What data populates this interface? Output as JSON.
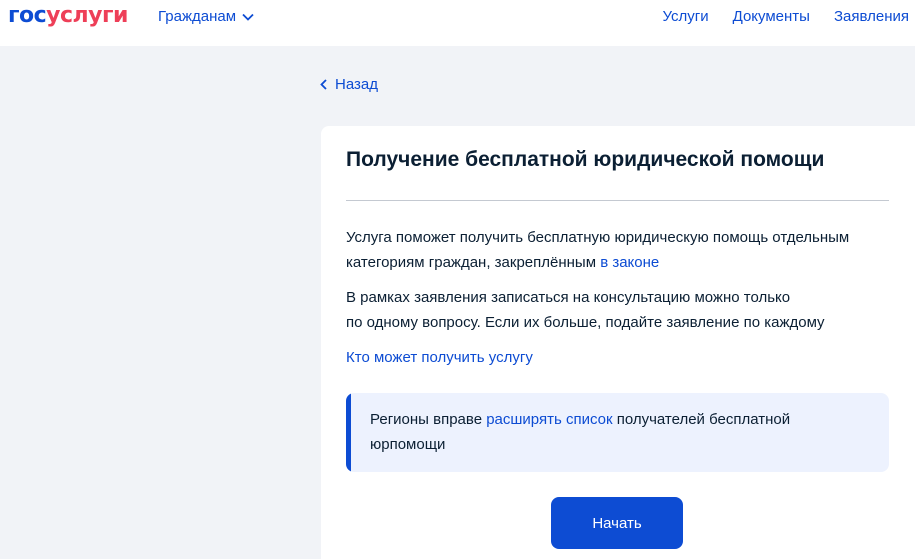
{
  "header": {
    "logo_part1": "гос",
    "logo_part2": "услуги",
    "citizens_menu": "Гражданам",
    "nav": [
      "Услуги",
      "Документы",
      "Заявления"
    ]
  },
  "back_label": "Назад",
  "card": {
    "title": "Получение бесплатной юридической помощи",
    "p1_text": "Услуга поможет получить бесплатную юридическую помощь отдельным категориям граждан, закреплённым ",
    "p1_link": "в законе",
    "p2_line1": "В рамках заявления записаться на консультацию можно только",
    "p2_line2": "по одному вопросу. Если их больше, подайте заявление по каждому",
    "who_link": "Кто может получить услугу",
    "notice_before": "Регионы вправе ",
    "notice_link": "расширять список",
    "notice_after": " получателей бесплатной юрпомощи",
    "start_button": "Начать"
  },
  "colors": {
    "brand_blue": "#0d4cd3",
    "brand_red": "#ee3f58",
    "page_bg": "#f1f3f7",
    "notice_bg": "#edf2fe"
  },
  "icons": {
    "citizens_caret": "chevron-down-icon",
    "back": "chevron-left-icon"
  }
}
